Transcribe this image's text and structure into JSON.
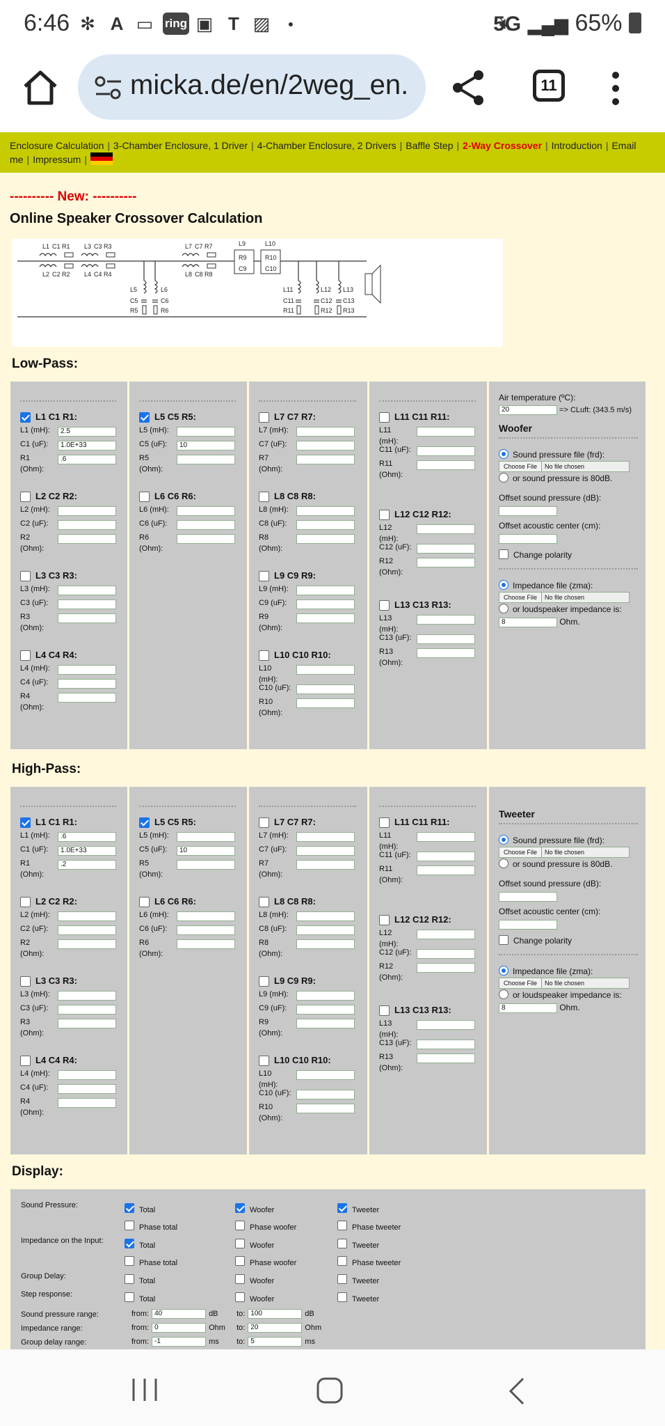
{
  "status": {
    "time": "6:46",
    "battery": "65%",
    "network": "5G",
    "ring_badge": "ring"
  },
  "browser": {
    "url": "micka.de/en/2weg_en.",
    "tab_count": "11"
  },
  "nav": {
    "items": [
      "Enclosure Calculation",
      "3-Chamber Enclosure, 1 Driver",
      "4-Chamber Enclosure, 2 Drivers",
      "Baffle Step",
      "2-Way Crossover",
      "Introduction",
      "Email me",
      "Impressum"
    ],
    "active": "2-Way Crossover"
  },
  "page": {
    "new_label": "---------- New: ----------",
    "title": "Online Speaker Crossover Calculation",
    "lowpass_title": "Low-Pass:",
    "highpass_title": "High-Pass:",
    "display_title": "Display:"
  },
  "diagram": {
    "labels": [
      "L1",
      "C1",
      "R1",
      "L2",
      "C2",
      "R2",
      "L3",
      "C3",
      "R3",
      "L4",
      "C4",
      "R4",
      "L5",
      "C5",
      "R5",
      "L6",
      "C6",
      "R6",
      "L7",
      "C7",
      "R7",
      "L8",
      "C8",
      "R8",
      "L9",
      "R9",
      "C9",
      "L10",
      "R10",
      "C10",
      "L11",
      "C11",
      "R11",
      "L12",
      "C12",
      "R12",
      "L13",
      "C13",
      "R13"
    ]
  },
  "lowpass": {
    "blocks": [
      {
        "title": "L1 C1 R1:",
        "checked": true,
        "L": "L1 (mH):",
        "C": "C1 (uF):",
        "R": "R1",
        "Lv": "2.5",
        "Cv": "1.0E+33",
        "Rv": ".6"
      },
      {
        "title": "L2 C2 R2:",
        "checked": false,
        "L": "L2 (mH):",
        "C": "C2 (uF):",
        "R": "R2",
        "Lv": "",
        "Cv": "",
        "Rv": ""
      },
      {
        "title": "L3 C3 R3:",
        "checked": false,
        "L": "L3 (mH):",
        "C": "C3 (uF):",
        "R": "R3",
        "Lv": "",
        "Cv": "",
        "Rv": ""
      },
      {
        "title": "L4 C4 R4:",
        "checked": false,
        "L": "L4 (mH):",
        "C": "C4 (uF):",
        "R": "R4",
        "Lv": "",
        "Cv": "",
        "Rv": ""
      },
      {
        "title": "L5 C5 R5:",
        "checked": true,
        "L": "L5 (mH):",
        "C": "C5 (uF):",
        "R": "R5",
        "Lv": "",
        "Cv": "10",
        "Rv": ""
      },
      {
        "title": "L6 C6 R6:",
        "checked": false,
        "L": "L6 (mH):",
        "C": "C6 (uF):",
        "R": "R6",
        "Lv": "",
        "Cv": "",
        "Rv": ""
      },
      {
        "title": "L7 C7 R7:",
        "checked": false,
        "L": "L7 (mH):",
        "C": "C7 (uF):",
        "R": "R7",
        "Lv": "",
        "Cv": "",
        "Rv": ""
      },
      {
        "title": "L8 C8 R8:",
        "checked": false,
        "L": "L8 (mH):",
        "C": "C8 (uF):",
        "R": "R8",
        "Lv": "",
        "Cv": "",
        "Rv": ""
      },
      {
        "title": "L9 C9 R9:",
        "checked": false,
        "L": "L9 (mH):",
        "C": "C9 (uF):",
        "R": "R9",
        "Lv": "",
        "Cv": "",
        "Rv": ""
      },
      {
        "title": "L10 C10 R10:",
        "checked": false,
        "L": "L10",
        "C": "C10 (uF):",
        "R": "R10",
        "Lv": "",
        "Cv": "",
        "Rv": ""
      },
      {
        "title": "L11 C11 R11:",
        "checked": false,
        "L": "L11",
        "C": "C11 (uF):",
        "R": "R11",
        "Lv": "",
        "Cv": "",
        "Rv": ""
      },
      {
        "title": "L12 C12 R12:",
        "checked": false,
        "L": "L12",
        "C": "C12 (uF):",
        "R": "R12",
        "Lv": "",
        "Cv": "",
        "Rv": ""
      },
      {
        "title": "L13 C13 R13:",
        "checked": false,
        "L": "L13",
        "C": "C13 (uF):",
        "R": "R13",
        "Lv": "",
        "Cv": "",
        "Rv": ""
      }
    ],
    "air_temp_label": "Air temperature (ºC):",
    "air_temp": "20",
    "air_result": "=> CLuft: (343.5 m/s)",
    "driver": "Woofer",
    "spl_file_label": "Sound pressure file (frd):",
    "choose": "Choose File",
    "no_file": "No file chosen",
    "spl_80": "or sound pressure is 80dB.",
    "offset_spl": "Offset sound pressure (dB):",
    "offset_ac": "Offset acoustic center (cm):",
    "polarity": "Change polarity",
    "imp_file": "Impedance file (zma):",
    "imp_alt": "or loudspeaker impedance is:",
    "imp_val": "8",
    "ohm": "Ohm."
  },
  "highpass": {
    "blocks": [
      {
        "title": "L1 C1 R1:",
        "checked": true,
        "L": "L1 (mH):",
        "C": "C1 (uF):",
        "R": "R1",
        "Lv": ".6",
        "Cv": "1.0E+33",
        "Rv": ".2"
      },
      {
        "title": "L2 C2 R2:",
        "checked": false,
        "L": "L2 (mH):",
        "C": "C2 (uF):",
        "R": "R2",
        "Lv": "",
        "Cv": "",
        "Rv": ""
      },
      {
        "title": "L3 C3 R3:",
        "checked": false,
        "L": "L3 (mH):",
        "C": "C3 (uF):",
        "R": "R3",
        "Lv": "",
        "Cv": "",
        "Rv": ""
      },
      {
        "title": "L4 C4 R4:",
        "checked": false,
        "L": "L4 (mH):",
        "C": "C4 (uF):",
        "R": "R4",
        "Lv": "",
        "Cv": "",
        "Rv": ""
      },
      {
        "title": "L5 C5 R5:",
        "checked": true,
        "L": "L5 (mH):",
        "C": "C5 (uF):",
        "R": "R5",
        "Lv": "",
        "Cv": "10",
        "Rv": ""
      },
      {
        "title": "L6 C6 R6:",
        "checked": false,
        "L": "L6 (mH):",
        "C": "C6 (uF):",
        "R": "R6",
        "Lv": "",
        "Cv": "",
        "Rv": ""
      },
      {
        "title": "L7 C7 R7:",
        "checked": false,
        "L": "L7 (mH):",
        "C": "C7 (uF):",
        "R": "R7",
        "Lv": "",
        "Cv": "",
        "Rv": ""
      },
      {
        "title": "L8 C8 R8:",
        "checked": false,
        "L": "L8 (mH):",
        "C": "C8 (uF):",
        "R": "R8",
        "Lv": "",
        "Cv": "",
        "Rv": ""
      },
      {
        "title": "L9 C9 R9:",
        "checked": false,
        "L": "L9 (mH):",
        "C": "C9 (uF):",
        "R": "R9",
        "Lv": "",
        "Cv": "",
        "Rv": ""
      },
      {
        "title": "L10 C10 R10:",
        "checked": false,
        "L": "L10",
        "C": "C10 (uF):",
        "R": "R10",
        "Lv": "",
        "Cv": "",
        "Rv": ""
      },
      {
        "title": "L11 C11 R11:",
        "checked": false,
        "L": "L11",
        "C": "C11 (uF):",
        "R": "R11",
        "Lv": "",
        "Cv": "",
        "Rv": ""
      },
      {
        "title": "L12 C12 R12:",
        "checked": false,
        "L": "L12",
        "C": "C12 (uF):",
        "R": "R12",
        "Lv": "",
        "Cv": "",
        "Rv": ""
      },
      {
        "title": "L13 C13 R13:",
        "checked": false,
        "L": "L13",
        "C": "C13 (uF):",
        "R": "R13",
        "Lv": "",
        "Cv": "",
        "Rv": ""
      }
    ],
    "driver": "Tweeter",
    "spl_file_label": "Sound pressure file (frd):",
    "choose": "Choose File",
    "no_file": "No file chosen",
    "spl_80": "or sound pressure is 80dB.",
    "offset_spl": "Offset sound pressure (dB):",
    "offset_ac": "Offset acoustic center (cm):",
    "polarity": "Change polarity",
    "imp_file": "Impedance file (zma):",
    "imp_alt": "or loudspeaker impedance is:",
    "imp_val": "8",
    "ohm": "Ohm."
  },
  "display": {
    "rows": [
      {
        "label": "Sound Pressure:",
        "items": [
          [
            "Total",
            true
          ],
          [
            "Woofer",
            true
          ],
          [
            "Tweeter",
            true
          ]
        ]
      },
      {
        "label": "",
        "items": [
          [
            "Phase total",
            false
          ],
          [
            "Phase woofer",
            false
          ],
          [
            "Phase tweeter",
            false
          ]
        ]
      },
      {
        "label": "Impedance on the Input:",
        "items": [
          [
            "Total",
            true
          ],
          [
            "Woofer",
            false
          ],
          [
            "Tweeter",
            false
          ]
        ]
      },
      {
        "label": "",
        "items": [
          [
            "Phase total",
            false
          ],
          [
            "Phase woofer",
            false
          ],
          [
            "Phase tweeter",
            false
          ]
        ]
      },
      {
        "label": "Group Delay:",
        "items": [
          [
            "Total",
            false
          ],
          [
            "Woofer",
            false
          ],
          [
            "Tweeter",
            false
          ]
        ]
      },
      {
        "label": "Step response:",
        "items": [
          [
            "Total",
            false
          ],
          [
            "Woofer",
            false
          ],
          [
            "Tweeter",
            false
          ]
        ]
      }
    ],
    "ranges": [
      {
        "label": "Sound pressure range:",
        "from": "40",
        "to": "100",
        "unit": "dB"
      },
      {
        "label": "Impedance range:",
        "from": "0",
        "to": "20",
        "unit": "Ohm"
      },
      {
        "label": "Group delay range:",
        "from": "-1",
        "to": "5",
        "unit": "ms"
      }
    ],
    "from_label": "from:",
    "to_label": "to:"
  }
}
